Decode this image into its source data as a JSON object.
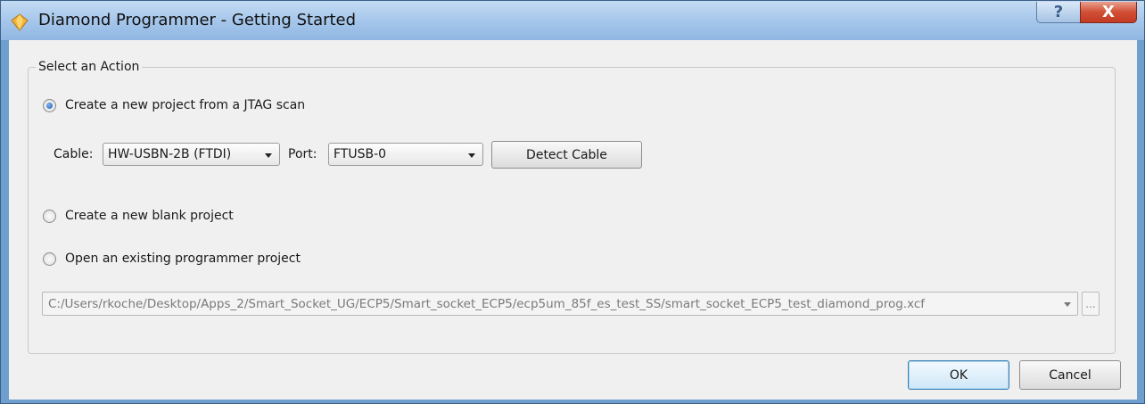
{
  "window": {
    "title": "Diamond Programmer - Getting Started",
    "help_label": "?",
    "close_label": "X"
  },
  "group": {
    "title": "Select an Action"
  },
  "options": {
    "jtag_scan": {
      "label": "Create a new project from a JTAG scan",
      "checked": true
    },
    "blank_project": {
      "label": "Create a new blank project",
      "checked": false
    },
    "open_existing": {
      "label": "Open an existing programmer project",
      "checked": false
    }
  },
  "cable": {
    "label": "Cable:",
    "value": "HW-USBN-2B (FTDI)"
  },
  "port": {
    "label": "Port:",
    "value": "FTUSB-0"
  },
  "detect_cable_label": "Detect Cable",
  "existing_project": {
    "path": "C:/Users/rkoche/Desktop/Apps_2/Smart_Socket_UG/ECP5/Smart_socket_ECP5/ecp5um_85f_es_test_SS/smart_socket_ECP5_test_diamond_prog.xcf",
    "browse_label": "..."
  },
  "buttons": {
    "ok": "OK",
    "cancel": "Cancel"
  },
  "colors": {
    "title_bar": "#a9c9ec",
    "close_button": "#c94a32",
    "dialog_background": "#f0f0f0"
  }
}
